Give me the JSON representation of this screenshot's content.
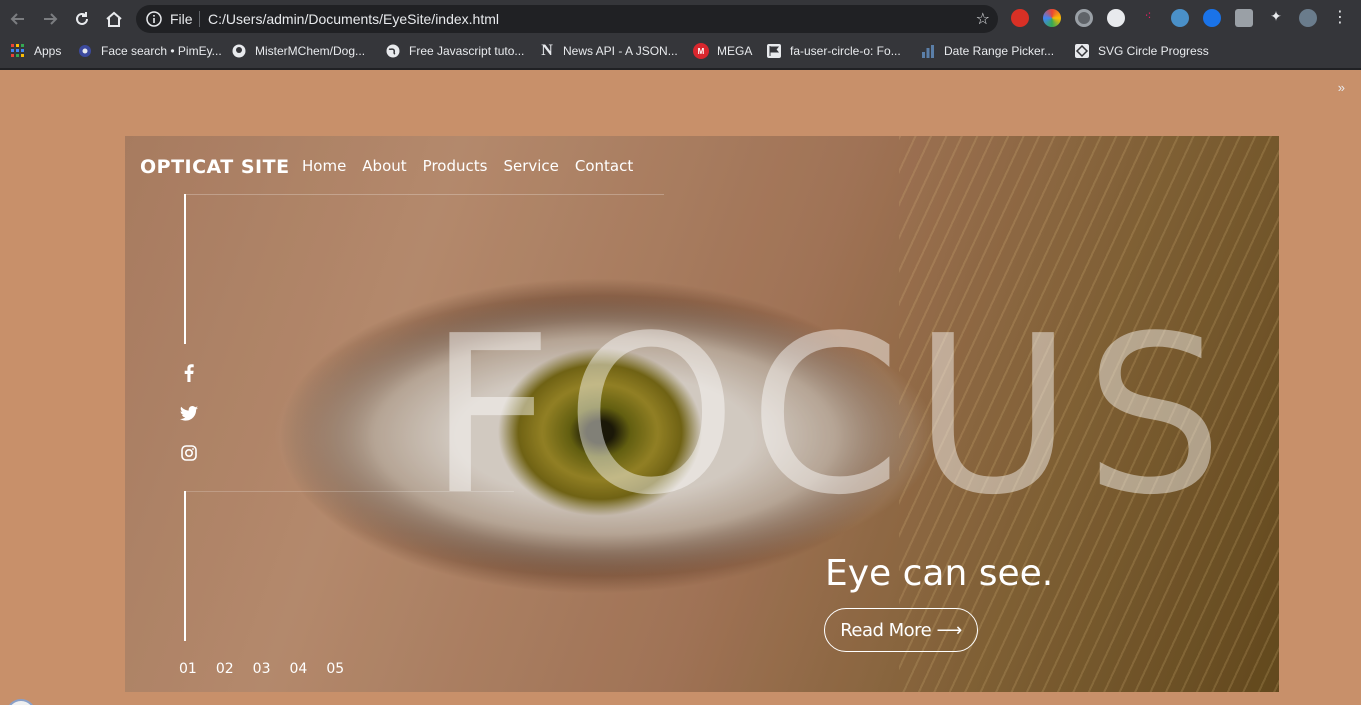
{
  "browser": {
    "omnibox": {
      "scheme_label": "File",
      "url": "C:/Users/admin/Documents/EyeSite/index.html"
    },
    "bookmarks": [
      {
        "label": "Apps",
        "icon": "apps-grid-icon"
      },
      {
        "label": "Face search • PimEy...",
        "icon": "pimeyes-icon"
      },
      {
        "label": "MisterMChem/Dog...",
        "icon": "github-icon"
      },
      {
        "label": "Free Javascript tuto...",
        "icon": "globe-icon"
      },
      {
        "label": "News API - A JSON...",
        "icon": "newsapi-icon"
      },
      {
        "label": "MEGA",
        "icon": "mega-icon"
      },
      {
        "label": "fa-user-circle-o: Fo...",
        "icon": "fontawesome-flag-icon"
      },
      {
        "label": "Date Range Picker...",
        "icon": "bar-chart-icon"
      },
      {
        "label": "SVG Circle Progress",
        "icon": "svg-icon"
      }
    ],
    "bookmarks_overflow": "»"
  },
  "site": {
    "logo": "OPTICAT SITE",
    "nav": [
      "Home",
      "About",
      "Products",
      "Service",
      "Contact"
    ],
    "social": [
      "facebook-icon",
      "twitter-icon",
      "instagram-icon"
    ],
    "hero_word": "FOCUS",
    "tagline": "Eye can see.",
    "cta": "Read More ⟶",
    "pager": [
      "01",
      "02",
      "03",
      "04",
      "05"
    ]
  },
  "colors": {
    "page_bg": "#c8906a",
    "chrome_bg": "#35363a",
    "omnibox_bg": "#202124",
    "text_light": "#ffffff"
  }
}
